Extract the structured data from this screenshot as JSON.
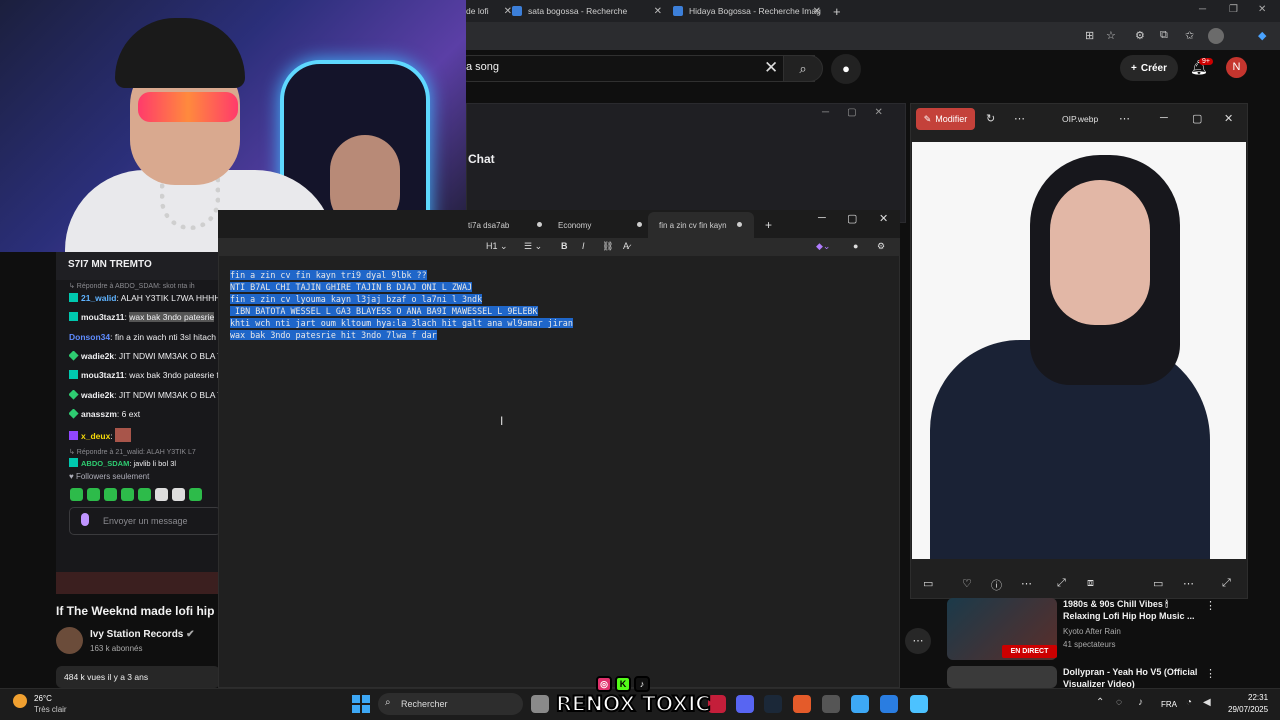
{
  "browser": {
    "tabs": [
      {
        "label": "de lofi"
      },
      {
        "label": "sata bogossa - Recherche"
      },
      {
        "label": "Hidaya Bogossa - Recherche Imag"
      }
    ],
    "new_tab": "+",
    "window_controls": [
      "─",
      "❐",
      "✕"
    ]
  },
  "youtube": {
    "search_value": "a song",
    "create_label": "Créer",
    "notification_badge": "9+",
    "avatar_letter": "N",
    "video_title": "If The Weeknd made lofi hip",
    "channel_name": "Ivy Station Records",
    "channel_subs": "163 k abonnés",
    "video_stats": "484 k vues  il y a 3 ans",
    "recommendations": [
      {
        "title": "1980s & 90s Chill Vibes 🕯 Relaxing Lofi Hip Hop Music ...",
        "channel": "Kyoto After Rain",
        "meta": "41 spectateurs",
        "live_badge": "EN DIRECT"
      },
      {
        "title": "Dollypran - Yeah Ho V5 (Official Visualizer Video)",
        "channel": "",
        "meta": ""
      }
    ]
  },
  "chat_popout": {
    "title": "Chat"
  },
  "twitch_chat": {
    "header": "S7I7 MN TREMTO",
    "messages": [
      {
        "kind": "meta",
        "text": "↳ Répondre à ABDO_SDAM: skot nta ih"
      },
      {
        "user": "21_walid",
        "text": "ALAH Y3TIK L7WA HHHH",
        "color": "#5fb3ff",
        "badge": "b-teal"
      },
      {
        "user": "mou3taz11",
        "text": "wax bak 3ndo patesrie",
        "color": "#e8e8e8",
        "badge": "b-teal"
      },
      {
        "user": "Donson34",
        "text": "fin a zin wach nti 3sl hitach",
        "color": "#5f8cff",
        "badge": ""
      },
      {
        "user": "wadie2k",
        "text": "JIT NDWI MM3AK O BLA T",
        "color": "#e8e8e8",
        "badge": "b-green"
      },
      {
        "user": "mou3taz11",
        "text": "wax bak 3ndo patesrie f",
        "color": "#e8e8e8",
        "badge": "b-teal"
      },
      {
        "user": "wadie2k",
        "text": "JIT NDWI MM3AK O BLA T",
        "color": "#e8e8e8",
        "badge": "b-green"
      },
      {
        "user": "anasszm",
        "text": "6 ext",
        "color": "#e8e8e8",
        "badge": "b-green"
      },
      {
        "user": "x_deux",
        "text": "",
        "color": "#f5d90a",
        "badge": "b-purple"
      },
      {
        "kind": "meta",
        "text": "↳ Répondre à 21_walid: ALAH Y3TIK L7"
      },
      {
        "user": "ABDO_SDAM",
        "text": "javlib li bol 3l",
        "color": "#2ecc71",
        "badge": "b-teal"
      }
    ],
    "followers_note": "♥ Followers seulement",
    "input_placeholder": "Envoyer un message"
  },
  "notepad": {
    "tabs": [
      {
        "label": "ti7a dsa7ab"
      },
      {
        "label": "Economy"
      },
      {
        "label": "fin a zin cv fin kayn"
      }
    ],
    "heading_select": "H1",
    "lines": [
      "fin a zin cv fin kayn tri9 dyal 9lbk ??",
      "NTI B7AL CHI TAJIN GHIRE TAJIN B DJAJ ONI L ZWAJ",
      "fin a zin cv lyouma kayn l3jaj bzaf o la7ni l 3ndk",
      " IBN BATOTA WESSEL L GA3 BLAYESS O ANA BA9I MAWESSEL L 9ELEBK",
      "khti wch nti jart oum kltoum hya:la 3lach hit galt ana wl9amar jiran",
      "wax bak 3ndo patesrie hit 3ndo 7lwa f dar"
    ]
  },
  "image_viewer": {
    "edit_label": "Modifier",
    "file_name": "OIP.webp"
  },
  "taskbar": {
    "temperature": "26°C",
    "weather": "Très clair",
    "search_label": "Rechercher",
    "language": "FRA",
    "time": "22:31",
    "date": "29/07/2025"
  },
  "overlay": {
    "brand": "RENOX TOXIC"
  }
}
